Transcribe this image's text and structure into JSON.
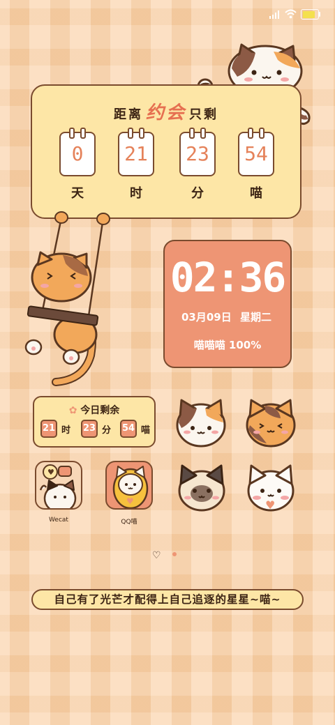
{
  "status": {
    "battery_level": 0.8
  },
  "countdown": {
    "title_prefix": "距离",
    "title_highlight": "约会",
    "title_suffix": "只剩",
    "items": [
      {
        "value": "0",
        "unit": "天"
      },
      {
        "value": "21",
        "unit": "时"
      },
      {
        "value": "23",
        "unit": "分"
      },
      {
        "value": "54",
        "unit": "喵"
      }
    ]
  },
  "clock": {
    "time": "02:36",
    "date": "03月09日",
    "weekday": "星期二",
    "battery": "喵喵喵 100%"
  },
  "today": {
    "title": "今日剩余",
    "hours": "21",
    "hours_unit": "时",
    "minutes": "23",
    "minutes_unit": "分",
    "seconds": "54",
    "seconds_unit": "喵"
  },
  "apps": [
    {
      "label": "Wecat"
    },
    {
      "label": "QQ喵"
    }
  ],
  "quote": "自己有了光芒才配得上自己追逐的星星~喵~",
  "colors": {
    "accent": "#ee9574",
    "card": "#fde6a6",
    "outline": "#7a4b2e"
  }
}
